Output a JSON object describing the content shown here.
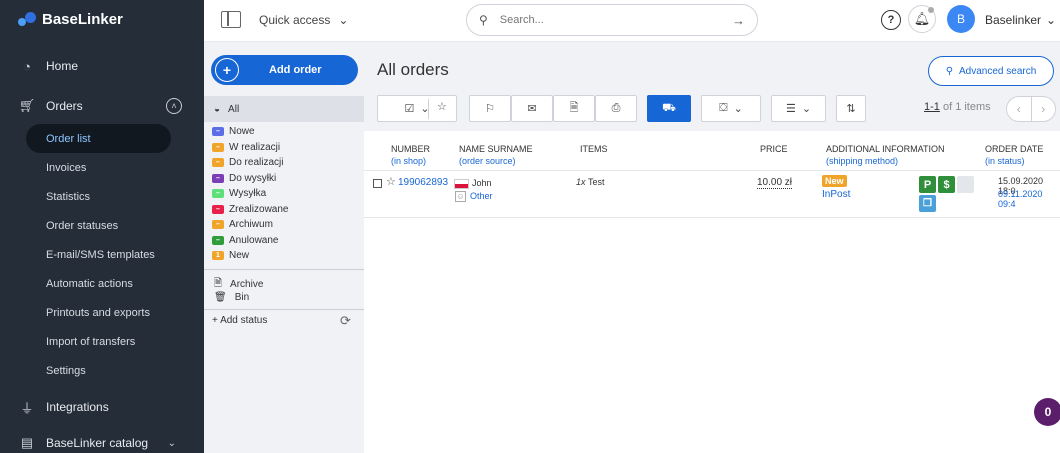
{
  "brand": {
    "name": "BaseLinker"
  },
  "sidebar": {
    "home": "Home",
    "orders": "Orders",
    "sub_items": [
      "Order list",
      "Invoices",
      "Statistics",
      "Order statuses",
      "E-mail/SMS templates",
      "Automatic actions",
      "Printouts and exports",
      "Import of transfers",
      "Settings"
    ],
    "integrations": "Integrations",
    "catalog": "BaseLinker catalog"
  },
  "topbar": {
    "quick_access": "Quick access",
    "search_placeholder": "Search...",
    "user_initial": "B",
    "user_name": "Baselinker"
  },
  "statuses": {
    "add_order": "Add order",
    "all": "All",
    "items": [
      {
        "label": "Nowe",
        "color": "#5b6ee8"
      },
      {
        "label": "W realizacji",
        "color": "#f0a52a"
      },
      {
        "label": "Do realizacji",
        "color": "#f0a52a"
      },
      {
        "label": "Do wysyłki",
        "color": "#7a3fb5"
      },
      {
        "label": "Wysyłka",
        "color": "#5de07a"
      },
      {
        "label": "Zrealizowane",
        "color": "#e8204a"
      },
      {
        "label": "Archiwum",
        "color": "#f0a52a"
      },
      {
        "label": "Anulowane",
        "color": "#2f9e3a"
      },
      {
        "label": "New",
        "color": "#f0a52a",
        "badge": "1"
      }
    ],
    "archive": "Archive",
    "bin": "Bin",
    "add_status": "+ Add status"
  },
  "main": {
    "title": "All orders",
    "advanced_search": "Advanced search",
    "pager_range": "1-1",
    "pager_suffix": " of 1 items"
  },
  "table": {
    "headers": {
      "number": "NUMBER",
      "number_sub": "(in shop)",
      "name": "NAME SURNAME",
      "name_sub": "(order source)",
      "items": "ITEMS",
      "price": "PRICE",
      "info": "ADDITIONAL INFORMATION",
      "info_sub": "(shipping method)",
      "date": "ORDER DATE",
      "date_sub": "(in status)"
    },
    "row": {
      "number": "199062893",
      "name": "John",
      "source": "Other",
      "qty": "1x",
      "item": "Test",
      "price": "10.00 zł",
      "status_badge": "New",
      "shipping": "InPost",
      "date": "15.09.2020 18:0",
      "status_date": "09.11.2020 09:4"
    }
  },
  "fab": {
    "count": "0"
  }
}
